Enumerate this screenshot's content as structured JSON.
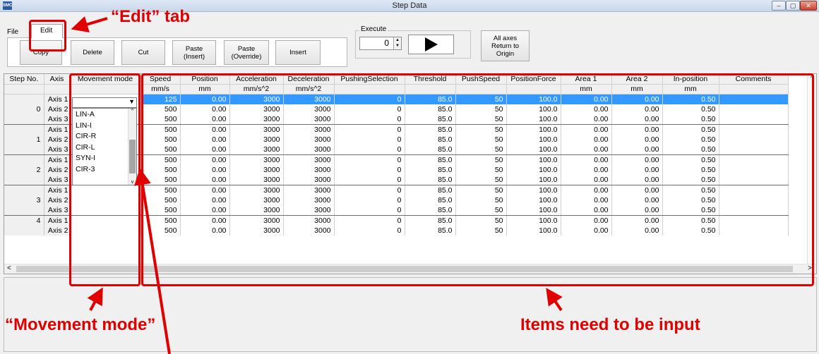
{
  "window": {
    "title": "Step Data",
    "app_icon_text": "SMC",
    "min_glyph": "–",
    "max_glyph": "▢",
    "close_glyph": "✕"
  },
  "tabs": {
    "file": "File",
    "edit": "Edit"
  },
  "toolbar": {
    "copy": "Copy",
    "delete": "Delete",
    "cut": "Cut",
    "paste_insert_line1": "Paste",
    "paste_insert_line2": "(Insert)",
    "paste_override_line1": "Paste",
    "paste_override_line2": "(Override)",
    "insert": "Insert"
  },
  "execute": {
    "label": "Execute",
    "value": "0",
    "play_icon": "play-icon"
  },
  "return_origin": {
    "line1": "All axes",
    "line2": "Return to",
    "line3": "Origin"
  },
  "grid": {
    "headers": [
      "Step No.",
      "Axis",
      "Movement mode",
      "Speed",
      "Position",
      "Acceleration",
      "Deceleration",
      "PushingSelection",
      "Threshold",
      "PushSpeed",
      "PositionForce",
      "Area 1",
      "Area 2",
      "In-position",
      "Comments"
    ],
    "units": [
      "",
      "",
      "",
      "mm/s",
      "mm",
      "mm/s^2",
      "mm/s^2",
      "",
      "",
      "",
      "",
      "mm",
      "mm",
      "mm",
      ""
    ],
    "rows": [
      {
        "step": "",
        "axis": "Axis 1",
        "values": [
          "125",
          "0.00",
          "3000",
          "3000",
          "0",
          "85.0",
          "50",
          "100.0",
          "0.00",
          "0.00",
          "0.50"
        ]
      },
      {
        "step": "0",
        "axis": "Axis 2",
        "values": [
          "500",
          "0.00",
          "3000",
          "3000",
          "0",
          "85.0",
          "50",
          "100.0",
          "0.00",
          "0.00",
          "0.50"
        ]
      },
      {
        "step": "",
        "axis": "Axis 3",
        "values": [
          "500",
          "0.00",
          "3000",
          "3000",
          "0",
          "85.0",
          "50",
          "100.0",
          "0.00",
          "0.00",
          "0.50"
        ]
      },
      {
        "step": "",
        "axis": "Axis 1",
        "values": [
          "500",
          "0.00",
          "3000",
          "3000",
          "0",
          "85.0",
          "50",
          "100.0",
          "0.00",
          "0.00",
          "0.50"
        ]
      },
      {
        "step": "1",
        "axis": "Axis 2",
        "values": [
          "500",
          "0.00",
          "3000",
          "3000",
          "0",
          "85.0",
          "50",
          "100.0",
          "0.00",
          "0.00",
          "0.50"
        ]
      },
      {
        "step": "",
        "axis": "Axis 3",
        "values": [
          "500",
          "0.00",
          "3000",
          "3000",
          "0",
          "85.0",
          "50",
          "100.0",
          "0.00",
          "0.00",
          "0.50"
        ]
      },
      {
        "step": "",
        "axis": "Axis 1",
        "values": [
          "500",
          "0.00",
          "3000",
          "3000",
          "0",
          "85.0",
          "50",
          "100.0",
          "0.00",
          "0.00",
          "0.50"
        ]
      },
      {
        "step": "2",
        "axis": "Axis 2",
        "values": [
          "500",
          "0.00",
          "3000",
          "3000",
          "0",
          "85.0",
          "50",
          "100.0",
          "0.00",
          "0.00",
          "0.50"
        ]
      },
      {
        "step": "",
        "axis": "Axis 3",
        "values": [
          "500",
          "0.00",
          "3000",
          "3000",
          "0",
          "85.0",
          "50",
          "100.0",
          "0.00",
          "0.00",
          "0.50"
        ]
      },
      {
        "step": "",
        "axis": "Axis 1",
        "values": [
          "500",
          "0.00",
          "3000",
          "3000",
          "0",
          "85.0",
          "50",
          "100.0",
          "0.00",
          "0.00",
          "0.50"
        ]
      },
      {
        "step": "3",
        "axis": "Axis 2",
        "values": [
          "500",
          "0.00",
          "3000",
          "3000",
          "0",
          "85.0",
          "50",
          "100.0",
          "0.00",
          "0.00",
          "0.50"
        ]
      },
      {
        "step": "",
        "axis": "Axis 3",
        "values": [
          "500",
          "0.00",
          "3000",
          "3000",
          "0",
          "85.0",
          "50",
          "100.0",
          "0.00",
          "0.00",
          "0.50"
        ]
      },
      {
        "step": "4",
        "axis": "Axis 1",
        "values": [
          "500",
          "0.00",
          "3000",
          "3000",
          "0",
          "85.0",
          "50",
          "100.0",
          "0.00",
          "0.00",
          "0.50"
        ]
      },
      {
        "step": "",
        "axis": "Axis 2",
        "values": [
          "500",
          "0.00",
          "3000",
          "3000",
          "0",
          "85.0",
          "50",
          "100.0",
          "0.00",
          "0.00",
          "0.50"
        ]
      }
    ]
  },
  "movement_mode_dropdown": {
    "selected": "",
    "options": [
      "LIN-A",
      "LIN-I",
      "CIR-R",
      "CIR-L",
      "SYN-I",
      "CIR-3"
    ],
    "up_arrow": "^",
    "down_arrow": "v"
  },
  "scroll": {
    "left_arrow": "<",
    "right_arrow": ">",
    "up_arrow": "^",
    "down_arrow": "v"
  },
  "annotations": {
    "edit_tab": "“Edit” tab",
    "movement_mode": "“Movement mode”",
    "items_input": "Items need to be input",
    "color": "#e00000"
  }
}
